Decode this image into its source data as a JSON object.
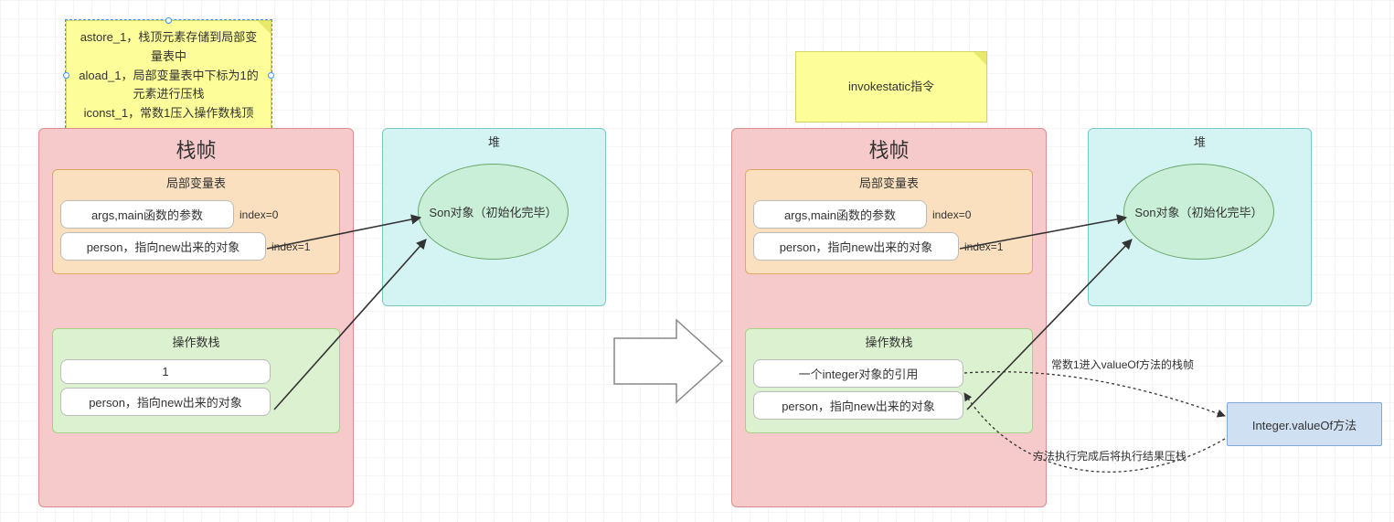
{
  "note_left": {
    "line1": "astore_1，栈顶元素存储到局部变量表中",
    "line2": "aload_1，局部变量表中下标为1的元素进行压栈",
    "line3": "iconst_1，常数1压入操作数栈顶"
  },
  "note_right": {
    "text": "invokestatic指令"
  },
  "frame_title": "栈帧",
  "heap_title": "堆",
  "locals_title": "局部变量表",
  "opstack_title": "操作数栈",
  "locals": {
    "row0": {
      "label": "args,main函数的参数",
      "index": "index=0"
    },
    "row1": {
      "label": "person，指向new出来的对象",
      "index": "index=1"
    }
  },
  "left_opstack": {
    "row0": "1",
    "row1": "person，指向new出来的对象"
  },
  "right_opstack": {
    "row0": "一个integer对象的引用",
    "row1": "person，指向new出来的对象"
  },
  "heap_object": "Son对象（初始化完毕）",
  "bluebox": "Integer.valueOf方法",
  "annot_top": "常数1进入valueOf方法的栈帧",
  "annot_bottom": "方法执行完成后将执行结果压栈"
}
